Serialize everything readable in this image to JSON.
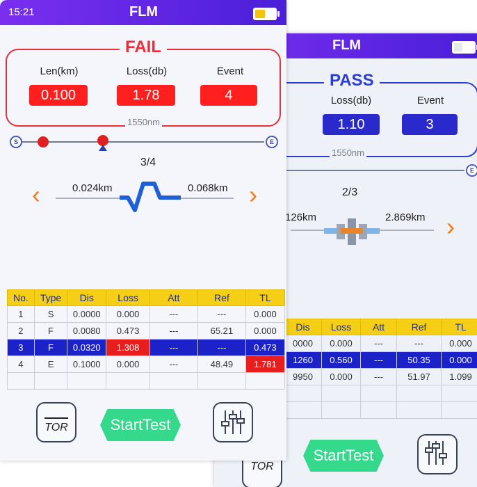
{
  "front": {
    "status_bar": {
      "time": "15:21",
      "title": "FLM",
      "battery_color": "#f5c40a"
    },
    "result": {
      "label": "FAIL",
      "color": "#e8303a",
      "wavelength": "1550nm",
      "columns": [
        {
          "header": "Len(km)",
          "value": "0.100"
        },
        {
          "header": "Loss(db)",
          "value": "1.78"
        },
        {
          "header": "Event",
          "value": "4"
        }
      ]
    },
    "link_map": {
      "start_cap": "S",
      "end_cap": "E"
    },
    "event_nav": {
      "counter": "3/4",
      "left_distance": "0.024km",
      "right_distance": "0.068km",
      "prev_glyph": "‹",
      "next_glyph": "›",
      "event_icon": "reflective-event-icon"
    },
    "table": {
      "headers": [
        "No.",
        "Type",
        "Dis",
        "Loss",
        "Att",
        "Ref",
        "TL"
      ],
      "rows": [
        [
          "1",
          "S",
          "0.0000",
          "0.000",
          "---",
          "---",
          "0.000"
        ],
        [
          "2",
          "F",
          "0.0080",
          "0.473",
          "---",
          "65.21",
          "0.000"
        ],
        [
          "3",
          "F",
          "0.0320",
          "1.308",
          "---",
          "---",
          "0.473"
        ],
        [
          "4",
          "E",
          "0.1000",
          "0.000",
          "---",
          "48.49",
          "1.781"
        ]
      ],
      "selected_row": 3
    },
    "bottom": {
      "tor_label": "TOR",
      "start_label": "StartTest",
      "settings_icon": "equalizer-sliders-icon"
    }
  },
  "back": {
    "status_bar": {
      "title": "FLM"
    },
    "result": {
      "label": "PASS",
      "color": "#2a3ed0",
      "wavelength": "1550nm",
      "columns": [
        {
          "header": "Loss(db)",
          "value": "1.10"
        },
        {
          "header": "Event",
          "value": "3"
        }
      ]
    },
    "link_map": {
      "end_cap": "E"
    },
    "event_nav": {
      "counter": "2/3",
      "left_distance": "126km",
      "right_distance": "2.869km",
      "next_glyph": "›",
      "event_icon": "connector-event-icon"
    },
    "table": {
      "headers": [
        "Dis",
        "Loss",
        "Att",
        "Ref",
        "TL"
      ],
      "rows": [
        [
          "0000",
          "0.000",
          "---",
          "---",
          "0.000"
        ],
        [
          "1260",
          "0.560",
          "---",
          "50.35",
          "0.000"
        ],
        [
          "9950",
          "0.000",
          "---",
          "51.97",
          "1.099"
        ]
      ],
      "selected_row": 2
    },
    "bottom": {
      "tor_label": "TOR",
      "start_label": "StartTest",
      "settings_icon": "equalizer-sliders-icon"
    }
  }
}
